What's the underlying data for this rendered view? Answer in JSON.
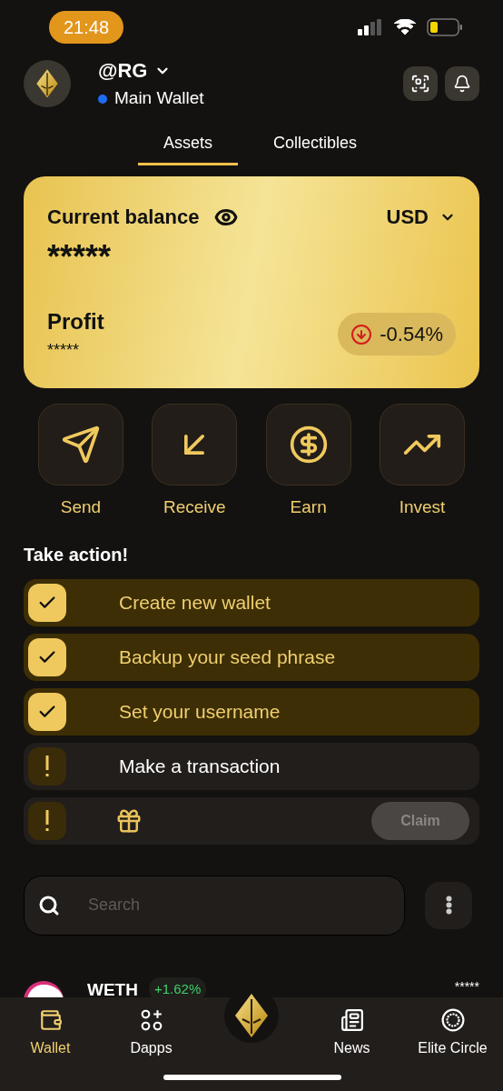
{
  "status_bar": {
    "time": "21:48"
  },
  "header": {
    "username": "@RG",
    "wallet": {
      "name": "Main Wallet",
      "color": "#1e6cf0"
    }
  },
  "tabs": [
    {
      "label": "Assets",
      "selected": true
    },
    {
      "label": "Collectibles",
      "selected": false
    }
  ],
  "balance_card": {
    "title": "Current balance",
    "currency": "USD",
    "balance": "*****",
    "profit_label": "Profit",
    "profit_value": "*****",
    "change": "-0.54%",
    "change_negative": true
  },
  "actions": [
    {
      "kind": "send",
      "label": "Send"
    },
    {
      "kind": "receive",
      "label": "Receive"
    },
    {
      "kind": "earn",
      "label": "Earn"
    },
    {
      "kind": "invest",
      "label": "Invest"
    }
  ],
  "tasks_title": "Take action!",
  "tasks": [
    {
      "kind": "task",
      "label": "Create new wallet",
      "checked": true
    },
    {
      "kind": "task",
      "label": "Backup your seed phrase",
      "checked": true
    },
    {
      "kind": "task",
      "label": "Set your username",
      "checked": true
    },
    {
      "kind": "task",
      "label": "Make a transaction",
      "checked": false
    },
    {
      "kind": "reward",
      "checked": false,
      "button": {
        "label": "Claim",
        "disabled": true
      }
    }
  ],
  "search": {
    "placeholder": "Search"
  },
  "tokens": [
    {
      "name": "WETH",
      "change": "+1.62%",
      "amount": "*****"
    }
  ],
  "bottom_nav": [
    {
      "kind": "wallet",
      "label": "Wallet",
      "selected": true
    },
    {
      "kind": "dapps",
      "label": "Dapps",
      "selected": false
    },
    {
      "kind": "logo"
    },
    {
      "kind": "news",
      "label": "News",
      "selected": false
    },
    {
      "kind": "elite",
      "label": "Elite Circle",
      "selected": false
    }
  ]
}
